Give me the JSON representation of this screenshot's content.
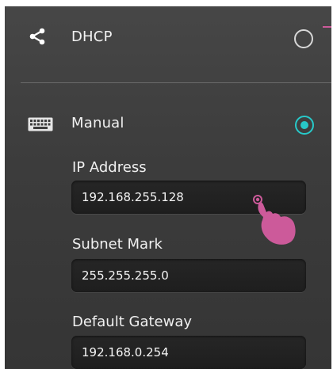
{
  "options": {
    "dhcp": {
      "label": "DHCP",
      "icon": "share-icon",
      "selected": false
    },
    "manual": {
      "label": "Manual",
      "icon": "keyboard-icon",
      "selected": true
    }
  },
  "fields": {
    "ip_address": {
      "label": "IP Address",
      "value": "192.168.255.128"
    },
    "subnet": {
      "label": "Subnet Mark",
      "value": "255.255.255.0"
    },
    "gateway": {
      "label": "Default Gateway",
      "value": "192.168.0.254"
    }
  },
  "colors": {
    "accent": "#27c9c9",
    "annotation": "#cc5a9a",
    "background": "#3e3e3e"
  },
  "annotation": {
    "icon": "pointing-hand-icon"
  }
}
